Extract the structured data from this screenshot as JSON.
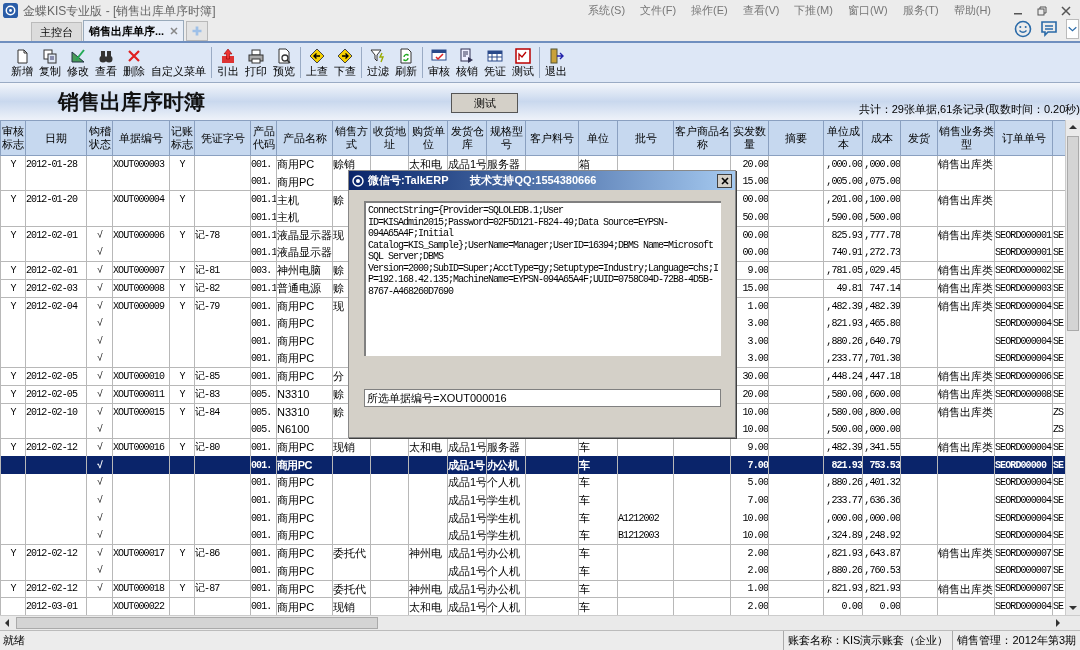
{
  "window": {
    "title": "金蝶KIS专业版 - [销售出库单序时簿]",
    "menus": [
      "系统(S)",
      "文件(F)",
      "操作(E)",
      "查看(V)",
      "下推(M)",
      "窗口(W)",
      "服务(T)",
      "帮助(H)"
    ]
  },
  "tabs": [
    {
      "label": "主控台",
      "selected": false,
      "closable": false
    },
    {
      "label": "销售出库单序...",
      "selected": true,
      "closable": true
    }
  ],
  "toolbar": {
    "groups": [
      [
        "新增",
        "复制",
        "修改",
        "查看",
        "删除",
        "自定义菜单"
      ],
      [
        "引出",
        "打印",
        "预览"
      ],
      [
        "上查",
        "下查"
      ],
      [
        "过滤",
        "刷新"
      ],
      [
        "审核",
        "核销",
        "凭证",
        "测试"
      ],
      [
        "退出"
      ]
    ]
  },
  "report": {
    "title": "销售出库序时簿",
    "button": "测试",
    "summary": "共计：29张单据,61条记录(取数时间：0.20秒)"
  },
  "table": {
    "columns": [
      "审核标志",
      "日期",
      "钩稽状态",
      "单据编号",
      "记账标志",
      "凭证字号",
      "产品代码",
      "产品名称",
      "销售方式",
      "收货地址",
      "购货单位",
      "发货仓库",
      "规格型号",
      "客户料号",
      "单位",
      "批号",
      "客户商品名称",
      "实发数量",
      "摘要",
      "单位成本",
      "成本",
      "发货",
      "销售业务类型",
      "订单单号"
    ],
    "rows": [
      {
        "selected": false,
        "cells": {
          "audit": "Y",
          "date": "2012-01-28",
          "bill_no": "XOUT000003",
          "posted": "Y",
          "code": "001.",
          "product": "商用PC",
          "mode": "赊销",
          "buyer": "太和电",
          "warehouse": "成品1号",
          "spec": "服务器",
          "unit": "箱",
          "qty": "20.00",
          "unit_cost": ",000.00",
          "cost": ",000.00",
          "biz_type": "销售出库类"
        }
      },
      {
        "selected": false,
        "cells": {
          "code": "001.",
          "product": "商用PC",
          "qty": "15.00",
          "unit_cost": ",005.00",
          "cost": ",075.00"
        }
      },
      {
        "selected": false,
        "cells": {
          "audit": "Y",
          "date": "2012-01-20",
          "bill_no": "XOUT000004",
          "posted": "Y",
          "code": "001.1",
          "product": "主机",
          "mode": "赊",
          "qty": "00.00",
          "unit_cost": ",201.00",
          "cost": ",100.00",
          "biz_type": "销售出库类"
        }
      },
      {
        "selected": false,
        "cells": {
          "code": "001.1",
          "product": "主机",
          "qty": "50.00",
          "unit_cost": ",590.00",
          "cost": ",500.00"
        }
      },
      {
        "selected": false,
        "cells": {
          "audit": "Y",
          "date": "2012-02-01",
          "check": "√",
          "bill_no": "XOUT000006",
          "posted": "Y",
          "voucher": "记-78",
          "code": "001.1",
          "product": "液晶显示器",
          "mode": "现",
          "qty": "00.00",
          "unit_cost": "825.93",
          "cost": ",777.78",
          "biz_type": "销售出库类",
          "order_no": "SEORD000001",
          "column_25": "SE"
        }
      },
      {
        "selected": false,
        "cells": {
          "check": "√",
          "code": "001.1",
          "product": "液晶显示器",
          "qty": "00.00",
          "unit_cost": "740.91",
          "cost": ",272.73",
          "order_no": "SEORD000001",
          "column_25": "SE"
        }
      },
      {
        "selected": false,
        "cells": {
          "audit": "Y",
          "date": "2012-02-01",
          "check": "√",
          "bill_no": "XOUT000007",
          "posted": "Y",
          "voucher": "记-81",
          "code": "003.",
          "product": "神州电脑",
          "mode": "赊",
          "qty": "9.00",
          "unit_cost": ",781.05",
          "cost": ",029.45",
          "biz_type": "销售出库类",
          "order_no": "SEORD000002",
          "column_25": "SE"
        }
      },
      {
        "selected": false,
        "cells": {
          "audit": "Y",
          "date": "2012-02-03",
          "check": "√",
          "bill_no": "XOUT000008",
          "posted": "Y",
          "voucher": "记-82",
          "code": "001.1",
          "product": "普通电源",
          "mode": "赊",
          "qty": "15.00",
          "unit_cost": "49.81",
          "cost": "747.14",
          "biz_type": "销售出库类",
          "order_no": "SEORD000003",
          "column_25": "SE"
        }
      },
      {
        "selected": false,
        "cells": {
          "audit": "Y",
          "date": "2012-02-04",
          "check": "√",
          "bill_no": "XOUT000009",
          "posted": "Y",
          "voucher": "记-79",
          "code": "001.",
          "product": "商用PC",
          "mode": "现",
          "qty": "1.00",
          "unit_cost": ",482.39",
          "cost": ",482.39",
          "biz_type": "销售出库类",
          "order_no": "SEORD000004",
          "column_25": "SE"
        }
      },
      {
        "selected": false,
        "cells": {
          "check": "√",
          "code": "001.",
          "product": "商用PC",
          "qty": "3.00",
          "unit_cost": ",821.93",
          "cost": ",465.80",
          "order_no": "SEORD000004",
          "column_25": "SE"
        }
      },
      {
        "selected": false,
        "cells": {
          "check": "√",
          "code": "001.",
          "product": "商用PC",
          "qty": "3.00",
          "unit_cost": ",880.26",
          "cost": ",640.79",
          "order_no": "SEORD000004",
          "column_25": "SE"
        }
      },
      {
        "selected": false,
        "cells": {
          "check": "√",
          "code": "001.",
          "product": "商用PC",
          "qty": "3.00",
          "unit_cost": ",233.77",
          "cost": ",701.30",
          "order_no": "SEORD000004",
          "column_25": "SE"
        }
      },
      {
        "selected": false,
        "cells": {
          "audit": "Y",
          "date": "2012-02-05",
          "check": "√",
          "bill_no": "XOUT000010",
          "posted": "Y",
          "voucher": "记-85",
          "code": "001.",
          "product": "商用PC",
          "mode": "分",
          "qty": "30.00",
          "unit_cost": ",448.24",
          "cost": ",447.18",
          "biz_type": "销售出库类",
          "order_no": "SEORD000006",
          "column_25": "SE"
        }
      },
      {
        "selected": false,
        "cells": {
          "audit": "Y",
          "date": "2012-02-05",
          "check": "√",
          "bill_no": "XOUT000011",
          "posted": "Y",
          "voucher": "记-83",
          "code": "005.",
          "product": "N3310",
          "mode": "赊",
          "qty": "20.00",
          "unit_cost": ",580.00",
          "cost": ",600.00",
          "biz_type": "销售出库类",
          "order_no": "SEORD000008",
          "column_25": "SE"
        }
      },
      {
        "selected": false,
        "cells": {
          "audit": "Y",
          "date": "2012-02-10",
          "check": "√",
          "bill_no": "XOUT000015",
          "posted": "Y",
          "voucher": "记-84",
          "code": "005.",
          "product": "N3310",
          "mode": "赊",
          "qty": "10.00",
          "unit_cost": ",580.00",
          "cost": ",800.00",
          "biz_type": "销售出库类",
          "column_25": "ZS"
        }
      },
      {
        "selected": false,
        "cells": {
          "check": "√",
          "code": "005.",
          "product": "N6100",
          "qty": "10.00",
          "unit_cost": ",500.00",
          "cost": ",000.00",
          "column_25": "ZS"
        }
      },
      {
        "selected": false,
        "cells": {
          "audit": "Y",
          "date": "2012-02-12",
          "check": "√",
          "bill_no": "XOUT000016",
          "posted": "Y",
          "voucher": "记-80",
          "code": "001.",
          "product": "商用PC",
          "mode": "现销",
          "buyer": "太和电",
          "warehouse": "成品1号",
          "spec": "服务器",
          "unit": "车",
          "qty": "9.00",
          "unit_cost": ",482.39",
          "cost": ",341.55",
          "biz_type": "销售出库类",
          "order_no": "SEORD000004",
          "column_25": "SE"
        }
      },
      {
        "selected": true,
        "cells": {
          "check": "√",
          "code": "001.",
          "product": "商用PC",
          "warehouse": "成品1号",
          "spec": "办公机",
          "unit": "车",
          "qty": "7.00",
          "unit_cost": "821.93",
          "cost": "753.53",
          "order_no": "SEORD00000",
          "column_25": "SE"
        }
      },
      {
        "selected": false,
        "cells": {
          "check": "√",
          "code": "001.",
          "product": "商用PC",
          "warehouse": "成品1号",
          "spec": "个人机",
          "unit": "车",
          "qty": "5.00",
          "unit_cost": ",880.26",
          "cost": ",401.32",
          "order_no": "SEORD000004",
          "column_25": "SE"
        }
      },
      {
        "selected": false,
        "cells": {
          "check": "√",
          "code": "001.",
          "product": "商用PC",
          "warehouse": "成品1号",
          "spec": "学生机",
          "unit": "车",
          "qty": "7.00",
          "unit_cost": ",233.77",
          "cost": ",636.36",
          "order_no": "SEORD000004",
          "column_25": "SE"
        }
      },
      {
        "selected": false,
        "cells": {
          "check": "√",
          "code": "001.",
          "product": "商用PC",
          "warehouse": "成品1号",
          "spec": "学生机",
          "unit": "车",
          "batch": "A1212002",
          "qty": "10.00",
          "unit_cost": ",000.00",
          "cost": ",000.00",
          "order_no": "SEORD000004",
          "column_25": "SE"
        }
      },
      {
        "selected": false,
        "cells": {
          "check": "√",
          "code": "001.",
          "product": "商用PC",
          "warehouse": "成品1号",
          "spec": "学生机",
          "unit": "车",
          "batch": "B1212003",
          "qty": "10.00",
          "unit_cost": ",324.89",
          "cost": ",248.92",
          "order_no": "SEORD000004",
          "column_25": "SE"
        }
      },
      {
        "selected": false,
        "cells": {
          "audit": "Y",
          "date": "2012-02-12",
          "check": "√",
          "bill_no": "XOUT000017",
          "posted": "Y",
          "voucher": "记-86",
          "code": "001.",
          "product": "商用PC",
          "mode": "委托代",
          "buyer": "神州电",
          "warehouse": "成品1号",
          "spec": "办公机",
          "unit": "车",
          "qty": "2.00",
          "unit_cost": ",821.93",
          "cost": ",643.87",
          "biz_type": "销售出库类",
          "order_no": "SEORD000007",
          "column_25": "SE"
        }
      },
      {
        "selected": false,
        "cells": {
          "check": "√",
          "code": "001.",
          "product": "商用PC",
          "warehouse": "成品1号",
          "spec": "个人机",
          "unit": "车",
          "qty": "2.00",
          "unit_cost": ",880.26",
          "cost": ",760.53",
          "order_no": "SEORD000007",
          "column_25": "SE"
        }
      },
      {
        "selected": false,
        "cells": {
          "audit": "Y",
          "date": "2012-02-12",
          "check": "√",
          "bill_no": "XOUT000018",
          "posted": "Y",
          "voucher": "记-87",
          "code": "001.",
          "product": "商用PC",
          "mode": "委托代",
          "buyer": "神州电",
          "warehouse": "成品1号",
          "spec": "办公机",
          "unit": "车",
          "qty": "1.00",
          "unit_cost": ",821.93",
          "cost": ",821.93",
          "biz_type": "销售出库类",
          "order_no": "SEORD000007",
          "column_25": "SE"
        }
      },
      {
        "selected": false,
        "cells": {
          "date": "2012-03-01",
          "bill_no": "XOUT000022",
          "code": "001.",
          "product": "商用PC",
          "mode": "现销",
          "buyer": "太和电",
          "warehouse": "成品1号",
          "spec": "个人机",
          "unit": "车",
          "qty": "2.00",
          "unit_cost": "0.00",
          "cost": "0.00",
          "order_no": "SEORD000004",
          "column_25": "SE"
        }
      }
    ]
  },
  "dialog": {
    "title": "微信号:TalkERP",
    "support": "技术支持QQ:1554380666",
    "text": "ConnectString={Provider=SQLOLEDB.1;User ID=KISAdmin2015;Password=02F5D121-F824-49;Data Source=EYPSN-094A65A4F;Initial Catalog=KIS_Sample};UserName=Manager;UserID=16394;DBMS Name=Microsoft SQL Server;DBMS Version=2000;SubID=Super;AcctType=gy;Setuptype=Industry;Language=chs;IP=192.168.42.135;MachineName=EYPSN-094A65A4F;UUID=0758C04D-72B8-4D5B-8767-A468260D7690",
    "field_value": "所选单据编号=XOUT000016"
  },
  "status_bar": {
    "left": "就绪",
    "panels": [
      "账套名称：KIS演示账套（企业）",
      "销售管理：2012年第3期"
    ]
  }
}
